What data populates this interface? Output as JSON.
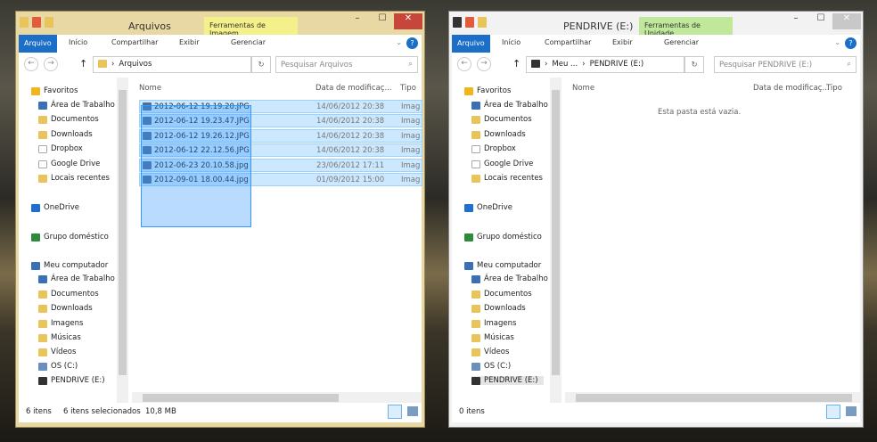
{
  "nav_common": [
    "Favoritos",
    "Área de Trabalho",
    "Documentos",
    "Downloads",
    "Dropbox",
    "Google Drive",
    "Locais recentes",
    "OneDrive",
    "Grupo doméstico",
    "Meu computador",
    "Área de Trabalho",
    "Documentos",
    "Downloads",
    "Imagens",
    "Músicas",
    "Vídeos",
    "OS (C:)",
    "PENDRIVE (E:)"
  ],
  "colors": {
    "file_tab": "#1b6fc8",
    "image_tools": "#f4f08a",
    "drive_tools": "#bfe89a",
    "close": "#c7463c",
    "selection": "#cce8ff"
  },
  "windows": [
    {
      "title": "Arquivos",
      "context_tab": "Ferramentas de Imagem",
      "tabs": [
        "Arquivo",
        "Início",
        "Compartilhar",
        "Exibir",
        "Gerenciar"
      ],
      "breadcrumb": [
        "Arquivos"
      ],
      "search_placeholder": "Pesquisar Arquivos",
      "columns": [
        "Nome",
        "Data de modificaç...",
        "Tipo"
      ],
      "files": [
        {
          "name": "2012-06-12 19.19.20.JPG",
          "date": "14/06/2012 20:38",
          "type": "Imag"
        },
        {
          "name": "2012-06-12 19.23.47.JPG",
          "date": "14/06/2012 20:38",
          "type": "Imag"
        },
        {
          "name": "2012-06-12 19.26.12.JPG",
          "date": "14/06/2012 20:38",
          "type": "Imag"
        },
        {
          "name": "2012-06-12 22.12.56.JPG",
          "date": "14/06/2012 20:38",
          "type": "Imag"
        },
        {
          "name": "2012-06-23 20.10.58.jpg",
          "date": "23/06/2012 17:11",
          "type": "Imag"
        },
        {
          "name": "2012-09-01 18.00.44.jpg",
          "date": "01/09/2012 15:00",
          "type": "Imag"
        }
      ],
      "empty_text": "",
      "status": {
        "count": "6 itens",
        "selected": "6 itens selecionados",
        "size": "10,8 MB"
      }
    },
    {
      "title": "PENDRIVE (E:)",
      "context_tab": "Ferramentas de Unidade",
      "tabs": [
        "Arquivo",
        "Início",
        "Compartilhar",
        "Exibir",
        "Gerenciar"
      ],
      "breadcrumb": [
        "Meu ...",
        "PENDRIVE (E:)"
      ],
      "search_placeholder": "Pesquisar PENDRIVE (E:)",
      "columns": [
        "Nome",
        "Data de modificaç...",
        "Tipo"
      ],
      "files": [],
      "empty_text": "Esta pasta está vazia.",
      "status": {
        "count": "0 itens",
        "selected": "",
        "size": ""
      }
    }
  ]
}
